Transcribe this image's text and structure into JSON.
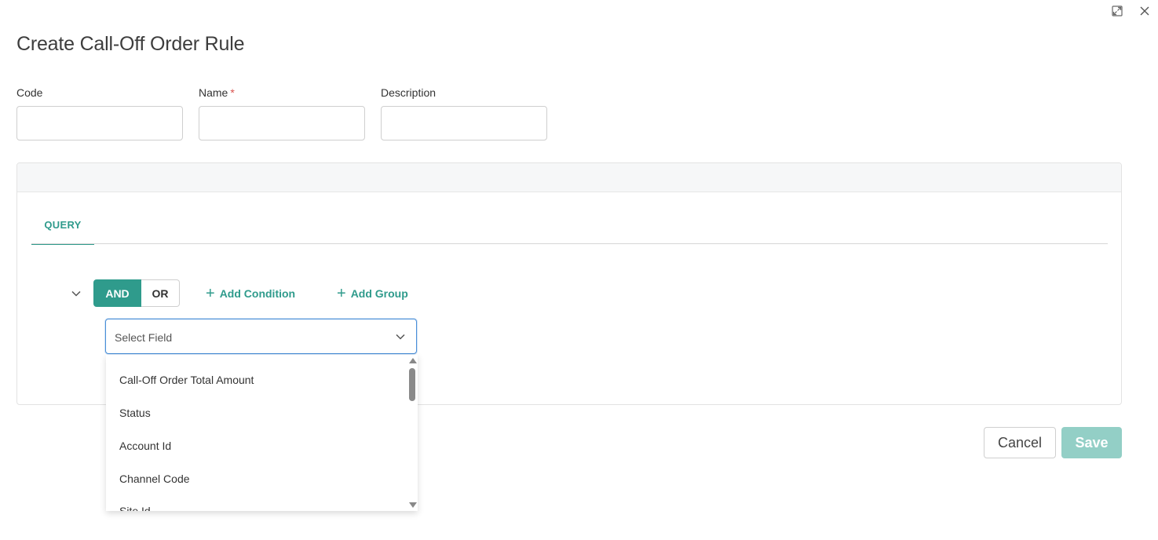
{
  "dialog": {
    "title": "Create Call-Off Order Rule",
    "icons": {
      "expand": "expand-icon",
      "close": "close-icon"
    }
  },
  "form": {
    "code": {
      "label": "Code",
      "value": ""
    },
    "name": {
      "label": "Name",
      "required_mark": "*",
      "value": ""
    },
    "description": {
      "label": "Description",
      "value": ""
    }
  },
  "query": {
    "tab_label": "QUERY",
    "and_label": "AND",
    "or_label": "OR",
    "add_condition": "Add Condition",
    "add_group": "Add Group",
    "select": {
      "placeholder": "Select Field",
      "options": [
        "Call-Off Order Total Amount",
        "Status",
        "Account Id",
        "Channel Code",
        "Site Id"
      ]
    }
  },
  "footer": {
    "cancel_label": "Cancel",
    "save_label": "Save"
  },
  "colors": {
    "accent": "#2f9b8c",
    "save_disabled": "#93cfc6",
    "focus_border": "#4a8fd8",
    "required": "#d9534f"
  }
}
